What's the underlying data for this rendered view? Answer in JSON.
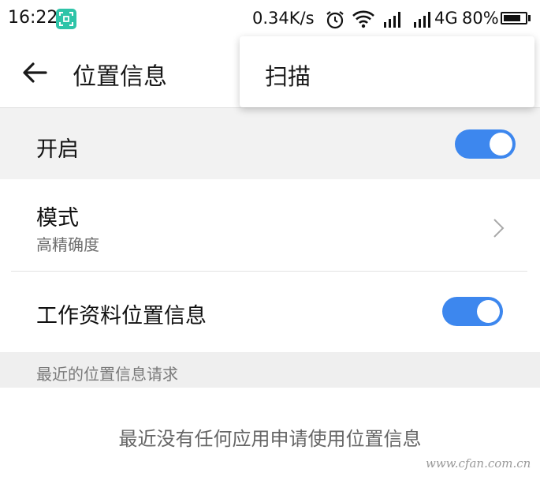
{
  "status_bar": {
    "time": "16:22",
    "speed": "0.34K/s",
    "network_type": "4G",
    "battery_percent": "80%",
    "battery_level": 0.8,
    "icons": [
      "screenshot-icon",
      "alarm-icon",
      "wifi-icon",
      "signal-icon",
      "signal-icon",
      "battery-icon"
    ]
  },
  "app_bar": {
    "title": "位置信息",
    "back_icon": "arrow-left-icon"
  },
  "menu": {
    "items": [
      {
        "label": "扫描"
      }
    ]
  },
  "settings": {
    "enable": {
      "label": "开启",
      "on": true
    },
    "mode": {
      "label": "模式",
      "value": "高精确度",
      "icon": "chevron-right-icon"
    },
    "work_profile": {
      "label": "工作资料位置信息",
      "on": true
    }
  },
  "recent": {
    "header": "最近的位置信息请求",
    "empty_message": "最近没有任何应用申请使用位置信息"
  },
  "watermark": "www.cfan.com.cn",
  "colors": {
    "accent": "#3d87ee",
    "screenshot_icon": "#2ec4a8"
  }
}
